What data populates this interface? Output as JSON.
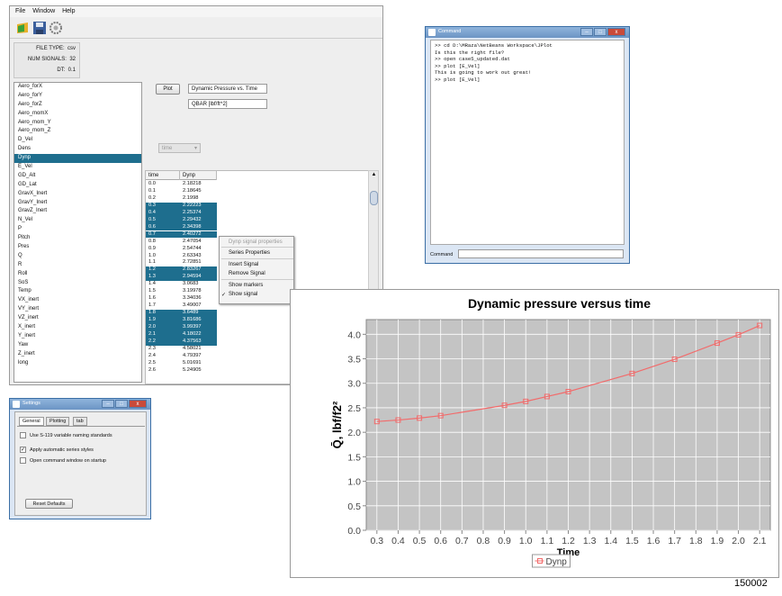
{
  "main": {
    "menu": [
      "File",
      "Window",
      "Help"
    ],
    "info": {
      "file_type_label": "FILE TYPE:",
      "file_type": "csv",
      "num_signals_label": "NUM SIGNALS:",
      "num_signals": "32",
      "dt_label": "DT:",
      "dt": "0.1"
    },
    "signals": [
      "Aero_forX",
      "Aero_forY",
      "Aero_forZ",
      "Aero_momX",
      "Aero_mom_Y",
      "Aero_mom_Z",
      "D_Vel",
      "Dens",
      "Dynp",
      "E_Vel",
      "GD_Alt",
      "GD_Lat",
      "GravX_Inert",
      "GravY_Inert",
      "GravZ_Inert",
      "N_Vel",
      "P",
      "Pitch",
      "Pres",
      "Q",
      "R",
      "Roll",
      "SoS",
      "Temp",
      "VX_inert",
      "VY_inert",
      "VZ_inert",
      "X_inert",
      "Y_inert",
      "Yaw",
      "Z_inert",
      "long"
    ],
    "selected_signal_index": 8,
    "plot_button": "Plot",
    "title_field": "Dynamic Pressure vs. Time",
    "ylabel_field": "QBAR [lbf/ft^2]",
    "x_combo": "time",
    "table": {
      "headers": [
        "time",
        "Dynp"
      ],
      "rows": [
        [
          "0.0",
          "2.18218"
        ],
        [
          "0.1",
          "2.18645"
        ],
        [
          "0.2",
          "2.1998"
        ],
        [
          "0.3",
          "2.22223"
        ],
        [
          "0.4",
          "2.25374"
        ],
        [
          "0.5",
          "2.29432"
        ],
        [
          "0.6",
          "2.34398"
        ],
        [
          "0.7",
          "2.40272"
        ],
        [
          "0.8",
          "2.47054"
        ],
        [
          "0.9",
          "2.54744"
        ],
        [
          "1.0",
          "2.63343"
        ],
        [
          "1.1",
          "2.72851"
        ],
        [
          "1.2",
          "2.83267"
        ],
        [
          "1.3",
          "2.94594"
        ],
        [
          "1.4",
          "3.0683"
        ],
        [
          "1.5",
          "3.19978"
        ],
        [
          "1.6",
          "3.34036"
        ],
        [
          "1.7",
          "3.49007"
        ],
        [
          "1.8",
          "3.6489"
        ],
        [
          "1.9",
          "3.81686"
        ],
        [
          "2.0",
          "3.99397"
        ],
        [
          "2.1",
          "4.18022"
        ],
        [
          "2.2",
          "4.37563"
        ],
        [
          "2.3",
          "4.58021"
        ],
        [
          "2.4",
          "4.79397"
        ],
        [
          "2.5",
          "5.01691"
        ],
        [
          "2.6",
          "5.24905"
        ]
      ],
      "selected_rows": [
        3,
        4,
        5,
        6,
        7,
        12,
        13,
        18,
        19,
        20,
        21,
        22
      ]
    },
    "context_menu": [
      "Dynp signal properties",
      "Series Properties",
      "Insert Signal",
      "Remove Signal",
      "Show markers",
      "Show signal"
    ],
    "context_checked": "Show signal"
  },
  "command": {
    "title": "Command",
    "lines": [
      ">> cd D:\\MRaza\\NetBeans Workspace\\JPlot",
      "Is this the right file?",
      ">> open case5_updated.dat",
      ">> plot [E_Vel]",
      "This is going to work out great!",
      ">> plot [E_Vel]"
    ],
    "input_label": "Command"
  },
  "settings": {
    "title": "Settings",
    "tabs": [
      "General",
      "Plotting",
      "tab"
    ],
    "options": [
      {
        "label": "Use S-119 variable naming standards",
        "checked": false
      },
      {
        "label": "Apply automatic series styles",
        "checked": true
      },
      {
        "label": "Open command window on startup",
        "checked": false
      }
    ],
    "reset_button": "Reset Defaults"
  },
  "chart_data": {
    "type": "line",
    "title": "Dynamic pressure versus time",
    "xlabel": "Time",
    "ylabel": "Q̄, lbf/f2²",
    "xlim": [
      0.25,
      2.15
    ],
    "ylim": [
      0.0,
      4.3
    ],
    "xticks": [
      0.3,
      0.4,
      0.5,
      0.6,
      0.7,
      0.8,
      0.9,
      1.0,
      1.1,
      1.2,
      1.3,
      1.4,
      1.5,
      1.6,
      1.7,
      1.8,
      1.9,
      2.0,
      2.1
    ],
    "yticks": [
      0.0,
      0.5,
      1.0,
      1.5,
      2.0,
      2.5,
      3.0,
      3.5,
      4.0
    ],
    "series": [
      {
        "name": "Dynp",
        "color": "#f26b6b",
        "x": [
          0.3,
          0.4,
          0.5,
          0.6,
          0.9,
          1.0,
          1.1,
          1.2,
          1.5,
          1.7,
          1.9,
          2.0,
          2.1
        ],
        "y": [
          2.22,
          2.25,
          2.29,
          2.34,
          2.55,
          2.63,
          2.73,
          2.83,
          3.2,
          3.49,
          3.82,
          3.99,
          4.18
        ]
      }
    ],
    "grid": true,
    "legend": "bottom-center",
    "background": "#c4c4c4"
  },
  "figure_label": "150002"
}
